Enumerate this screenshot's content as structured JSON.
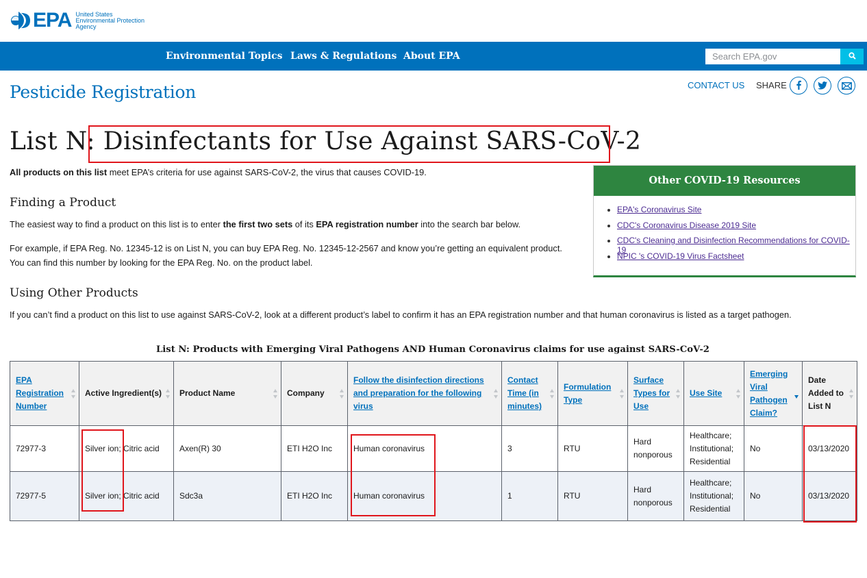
{
  "agency": {
    "logo_text": "EPA",
    "sub_lines": [
      "United States",
      "Environmental Protection",
      "Agency"
    ],
    "brand_color": "#0071bc"
  },
  "nav": {
    "items": [
      "Environmental Topics",
      "Laws & Regulations",
      "About EPA"
    ],
    "search_placeholder": "Search EPA.gov"
  },
  "header": {
    "section_title": "Pesticide Registration",
    "contact_label": "CONTACT US",
    "share_label": "SHARE",
    "share_icons": [
      "facebook-icon",
      "twitter-icon",
      "email-icon"
    ]
  },
  "page": {
    "title": "List N: Disinfectants for Use Against SARS-CoV-2",
    "intro_bold": "All products on this list",
    "intro_rest": " meet EPA’s criteria for use against SARS-CoV-2, the virus that causes COVID-19.",
    "finding_heading": "Finding a Product",
    "finding_p1_a": "The easiest way to find a product on this list is to enter ",
    "finding_p1_b": "the first two sets",
    "finding_p1_c": " of its ",
    "finding_p1_d": "EPA registration number",
    "finding_p1_e": " into the search bar below.",
    "finding_p2_line1": "For example, if EPA Reg. No. 12345-12 is on List N, you can buy EPA Reg. No. 12345-12-2567 and know you’re getting an equivalent product.",
    "finding_p2_line2": "You can find this number by looking for the EPA Reg. No. on the product label.",
    "other_heading": "Using Other Products",
    "other_p": "If you can’t find a product on this list to use against SARS-CoV-2, look at a different product’s label to confirm it has an EPA registration number and that human coronavirus is listed as a target pathogen."
  },
  "resources": {
    "heading": "Other COVID-19 Resources",
    "links": [
      "EPA's Coronavirus Site",
      "CDC's Coronavirus Disease 2019 Site",
      "CDC's Cleaning and Disinfection Recommendations for COVID-19",
      "NPIC 's COVID-19 Virus Factsheet"
    ],
    "accent_color": "#2e8540"
  },
  "table": {
    "caption": "List N: Products with Emerging Viral Pathogens AND Human Coronavirus claims for use against SARS-CoV-2",
    "headers": [
      "EPA Registration Number",
      "Active Ingredient(s)",
      "Product Name",
      "Company",
      "Follow the disinfection directions and preparation for the following virus",
      "Contact Time (in minutes)",
      "Formulation Type",
      "Surface Types for Use",
      "Use Site",
      "Emerging Viral Pathogen Claim?",
      "Date Added to List N"
    ],
    "rows": [
      {
        "reg_no": "72977-3",
        "ingredients": "Silver ion; Citric acid",
        "product": "Axen(R) 30",
        "company": "ETI H2O Inc",
        "virus": "Human coronavirus",
        "contact_time": "3",
        "formulation": "RTU",
        "surface": "Hard nonporous",
        "use_site": "Healthcare; Institutional; Residential",
        "evp_claim": "No",
        "date_added": "03/13/2020"
      },
      {
        "reg_no": "72977-5",
        "ingredients": "Silver ion; Citric acid",
        "product": "Sdc3a",
        "company": "ETI H2O Inc",
        "virus": "Human coronavirus",
        "contact_time": "1",
        "formulation": "RTU",
        "surface": "Hard nonporous",
        "use_site": "Healthcare; Institutional; Residential",
        "evp_claim": "No",
        "date_added": "03/13/2020"
      }
    ],
    "highlight_color": "#e0161c"
  }
}
